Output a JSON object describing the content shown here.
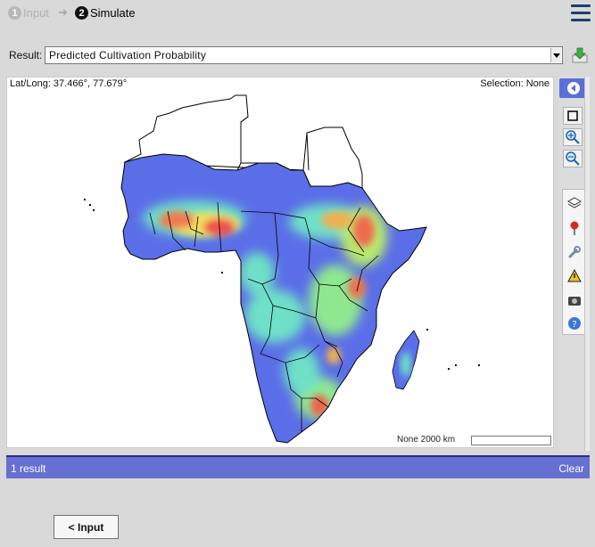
{
  "steps": [
    {
      "number": "1",
      "label": "Input"
    },
    {
      "number": "2",
      "label": "Simulate"
    }
  ],
  "step_arrow": "➜",
  "result": {
    "label": "Result:",
    "selected": "Predicted Cultivation Probability"
  },
  "map": {
    "latlong": "Lat/Long: 37.466°, 77.679°",
    "selection": "Selection: None",
    "scale_text": "None  2000 km"
  },
  "status": {
    "count": "1 result",
    "clear": "Clear"
  },
  "footer": {
    "input_button": "< Input"
  },
  "colors": {
    "accent": "#6670d0",
    "status_border": "#2a2f7a",
    "menu_icon": "#1d3f6e",
    "low_probability": "#5a6ee8",
    "mid_probability": "#6ee0c8",
    "high_probability": "#f05050"
  },
  "icons": [
    "menu-icon",
    "download-icon",
    "collapse-left-icon",
    "select-box-icon",
    "zoom-in-icon",
    "zoom-out-icon",
    "layers-icon",
    "map-pin-icon",
    "wrench-icon",
    "warning-icon",
    "camera-icon",
    "help-icon"
  ]
}
